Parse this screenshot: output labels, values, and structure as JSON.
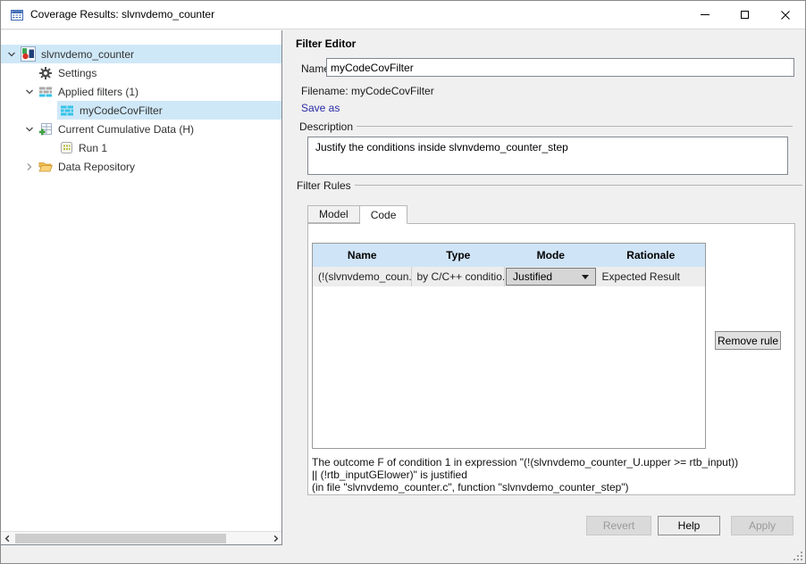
{
  "window": {
    "title": "Coverage Results: slvnvdemo_counter"
  },
  "tree": {
    "items": [
      {
        "label": "slvnvdemo_counter"
      },
      {
        "label": "Settings"
      },
      {
        "label": "Applied filters (1)"
      },
      {
        "label": "myCodeCovFilter"
      },
      {
        "label": "Current Cumulative Data (H)"
      },
      {
        "label": "Run 1"
      },
      {
        "label": "Data Repository"
      }
    ]
  },
  "editor": {
    "title": "Filter Editor",
    "name_label": "Name",
    "name_value": "myCodeCovFilter",
    "filename_text": "Filename: myCodeCovFilter",
    "save_as_label": "Save as",
    "description_label": "Description",
    "description_value": "Justify the conditions inside slvnvdemo_counter_step",
    "filter_rules_label": "Filter Rules",
    "tabs": {
      "model": "Model",
      "code": "Code",
      "active": "Code"
    },
    "table": {
      "headers": [
        "Name",
        "Type",
        "Mode",
        "Rationale"
      ],
      "rows": [
        {
          "name": "(!(slvnvdemo_coun...",
          "type": "by C/C++ conditio...",
          "mode": "Justified",
          "rationale": "Expected Result"
        }
      ]
    },
    "remove_rule_label": "Remove rule",
    "footnote": [
      "The outcome F of condition 1 in expression \"(!(slvnvdemo_counter_U.upper >= rtb_input))",
      "|| (!rtb_inputGElower)\" is justified",
      "(in file \"slvnvdemo_counter.c\", function \"slvnvdemo_counter_step\")"
    ],
    "buttons": {
      "revert": "Revert",
      "help": "Help",
      "apply": "Apply",
      "revert_disabled": true,
      "apply_disabled": true
    }
  },
  "colors": {
    "selection": "#cfe8f8",
    "table_header": "#cfe4f7",
    "link": "#2b2ba6",
    "panel_bg": "#f0f0f0"
  }
}
